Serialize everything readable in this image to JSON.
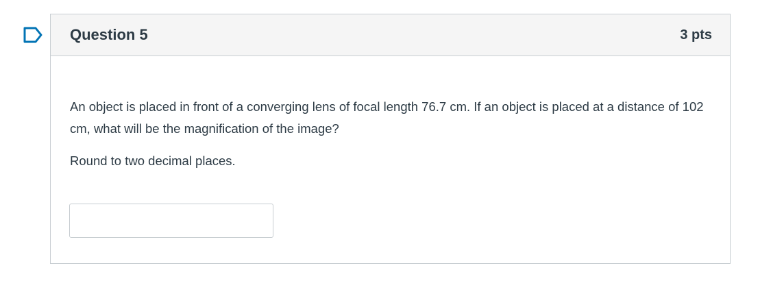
{
  "question": {
    "title": "Question 5",
    "points": "3 pts",
    "text": "An object is placed in front of a converging lens of focal length 76.7 cm. If an object is placed at a distance of 102 cm, what will be the magnification of the image?",
    "instruction": "Round to two decimal places.",
    "answer_value": ""
  },
  "icons": {
    "flag": "flag-question-icon"
  },
  "colors": {
    "accent": "#0374b5",
    "border": "#c7cdd1",
    "header_bg": "#f5f5f5",
    "text": "#2d3b45"
  }
}
